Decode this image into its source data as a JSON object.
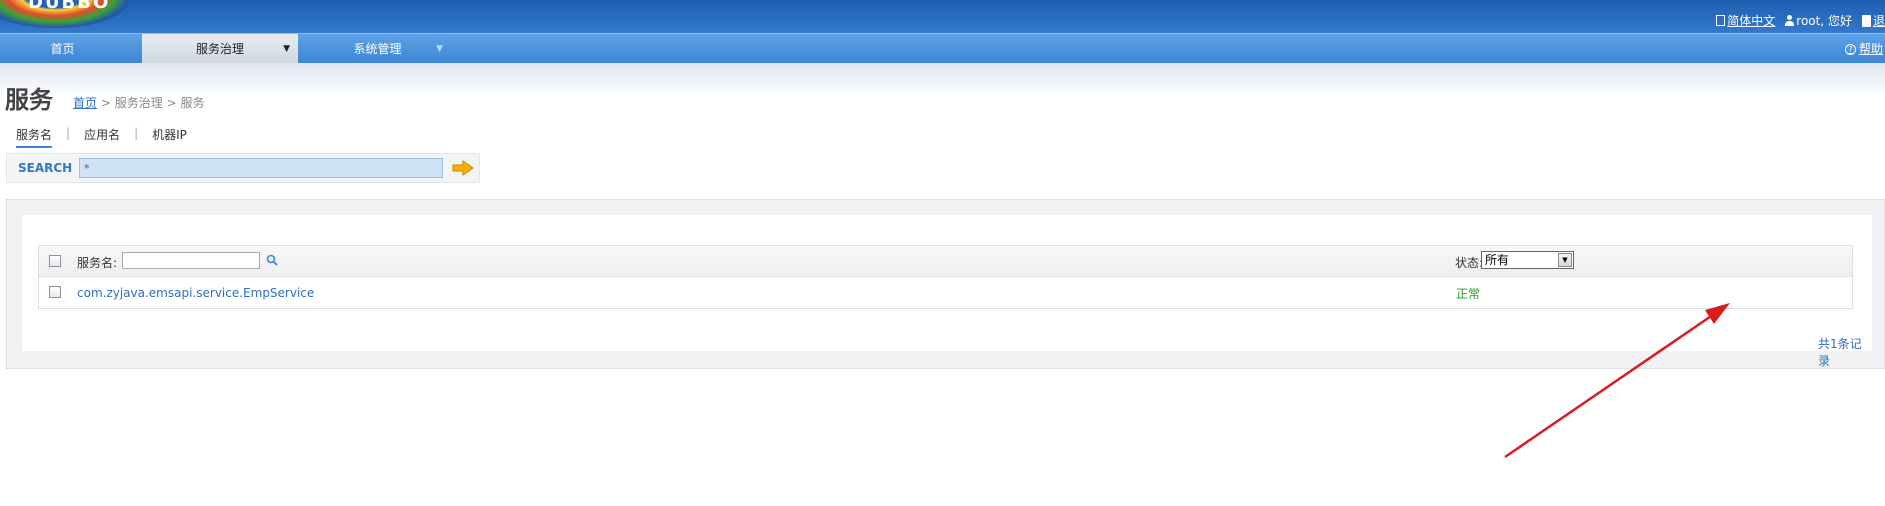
{
  "header": {
    "logo_text": "DUBBO",
    "lang_link": "简体中文",
    "user_greeting": "root, 您好",
    "logout_label": "退"
  },
  "nav": {
    "home": "首页",
    "service_governance": "服务治理",
    "system_admin": "系统管理",
    "help": "帮助"
  },
  "page": {
    "title": "服务",
    "breadcrumb": {
      "home": "首页",
      "sep": ">",
      "level1": "服务治理",
      "level2": "服务"
    }
  },
  "search": {
    "tabs": [
      "服务名",
      "应用名",
      "机器IP"
    ],
    "active_tab": "服务名",
    "label": "SEARCH",
    "value": "*"
  },
  "table": {
    "name_filter_label": "服务名:",
    "status_label": "状态:",
    "status_selected": "所有",
    "rows": [
      {
        "service": "com.zyjava.emsapi.service.EmpService",
        "status": "正常"
      }
    ],
    "total": "共1条记录"
  },
  "colors": {
    "header_blue": "#2a6ec2",
    "link_blue": "#2e6fc0",
    "status_ok": "#2b9a2b",
    "annotation_arrow": "#d91c1c"
  }
}
